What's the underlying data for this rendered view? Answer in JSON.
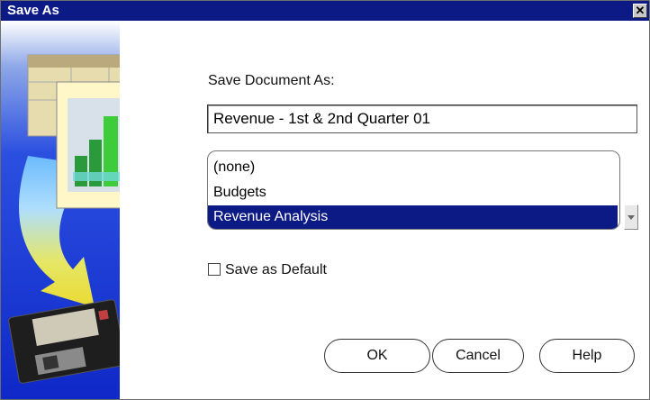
{
  "window": {
    "title": "Save As",
    "close_glyph": "✕",
    "accent_color": "#0c1a86"
  },
  "form": {
    "save_label": "Save Document As:",
    "document_name": "Revenue - 1st & 2nd Quarter 01",
    "list_items": [
      {
        "label": "(none)",
        "selected": false
      },
      {
        "label": "Budgets",
        "selected": false
      },
      {
        "label": "Revenue Analysis",
        "selected": true
      }
    ],
    "default_checkbox": {
      "label": "Save as Default",
      "checked": false
    }
  },
  "buttons": {
    "ok": "OK",
    "cancel": "Cancel",
    "help": "Help"
  },
  "icons": [
    "close-icon",
    "dropdown-arrow-icon",
    "save-illustration"
  ]
}
